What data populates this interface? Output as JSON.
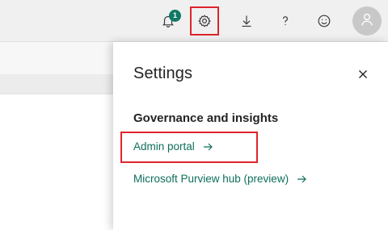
{
  "topbar": {
    "notifications_count": "1",
    "icons": [
      "bell-icon",
      "gear-icon",
      "download-icon",
      "help-icon",
      "smiley-icon",
      "person-icon"
    ]
  },
  "settings_panel": {
    "title": "Settings",
    "section_heading": "Governance and insights",
    "links": [
      {
        "label": "Admin portal",
        "icon": "arrow-right-icon"
      },
      {
        "label": "Microsoft Purview hub (preview)",
        "icon": "arrow-right-icon"
      }
    ]
  },
  "colors": {
    "link": "#0e6e5c",
    "badge": "#117865",
    "highlight": "#e0242b"
  }
}
